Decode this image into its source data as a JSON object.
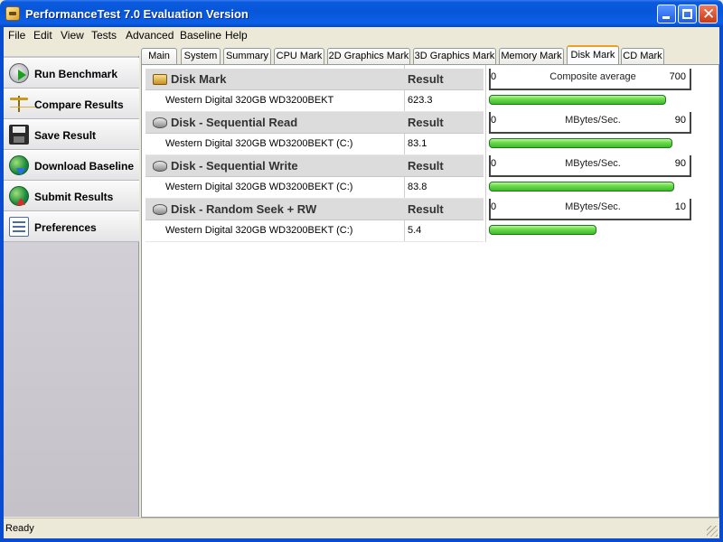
{
  "window": {
    "title": "PerformanceTest 7.0 Evaluation Version"
  },
  "menu": [
    "File",
    "Edit",
    "View",
    "Tests",
    "Advanced",
    "Baseline",
    "Help"
  ],
  "sidebar": {
    "items": [
      {
        "label": "Run Benchmark",
        "icon": "run-benchmark-icon"
      },
      {
        "label": "Compare Results",
        "icon": "scale-icon"
      },
      {
        "label": "Save Result",
        "icon": "floppy-disk-icon"
      },
      {
        "label": "Download Baseline",
        "icon": "globe-download-icon"
      },
      {
        "label": "Submit Results",
        "icon": "globe-upload-icon"
      },
      {
        "label": "Preferences",
        "icon": "preferences-icon"
      }
    ]
  },
  "tabs": [
    "Main",
    "System",
    "Summary",
    "CPU Mark",
    "2D Graphics Mark",
    "3D Graphics Mark",
    "Memory Mark",
    "Disk Mark",
    "CD Mark"
  ],
  "active_tab": "Disk Mark",
  "sections": [
    {
      "title": "Disk Mark",
      "result_header": "Result",
      "device": "Western Digital 320GB WD3200BEKT",
      "value": "623.3",
      "scale_min": "0",
      "scale_label": "Composite average",
      "scale_max": "700",
      "fraction": 0.89
    },
    {
      "title": "Disk - Sequential Read",
      "result_header": "Result",
      "device": "Western Digital 320GB WD3200BEKT (C:)",
      "value": "83.1",
      "scale_min": "0",
      "scale_label": "MBytes/Sec.",
      "scale_max": "90",
      "fraction": 0.923
    },
    {
      "title": "Disk - Sequential Write",
      "result_header": "Result",
      "device": "Western Digital 320GB WD3200BEKT (C:)",
      "value": "83.8",
      "scale_min": "0",
      "scale_label": "MBytes/Sec.",
      "scale_max": "90",
      "fraction": 0.931
    },
    {
      "title": "Disk - Random Seek + RW",
      "result_header": "Result",
      "device": "Western Digital 320GB WD3200BEKT (C:)",
      "value": "5.4",
      "scale_min": "0",
      "scale_label": "MBytes/Sec.",
      "scale_max": "10",
      "fraction": 0.54
    }
  ],
  "status": {
    "text": "Ready"
  },
  "colors": {
    "titlebar": "#0856d8",
    "bar_fill": "#3cbc2a",
    "tab_highlight": "#f0a020"
  }
}
